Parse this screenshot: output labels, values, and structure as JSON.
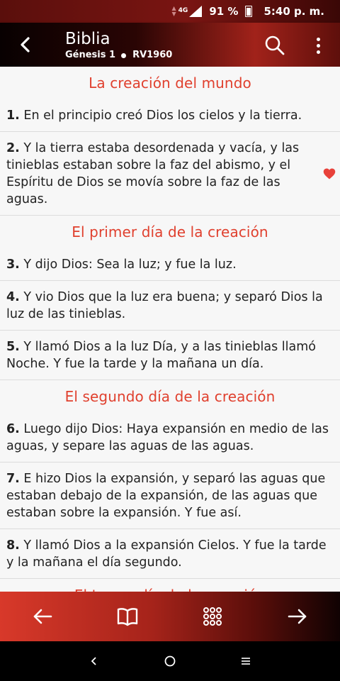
{
  "status_bar": {
    "network": "4G",
    "battery_text": "91 %",
    "battery_level": 0.91,
    "time": "5:40 p. m."
  },
  "app_bar": {
    "title": "Biblia",
    "chapter": "Génesis 1",
    "version": "RV1960"
  },
  "sections": [
    {
      "title": "La creación del mundo",
      "verses": [
        {
          "num": "1.",
          "text": " En el principio creó Dios los cielos y la tierra.",
          "favorite": false
        },
        {
          "num": "2.",
          "text": " Y la tierra estaba desordenada y vacía, y las tinieblas estaban sobre la faz del abismo, y el Espíritu de Dios se movía sobre la faz de las aguas.",
          "favorite": true
        }
      ]
    },
    {
      "title": "El primer día de la creación",
      "verses": [
        {
          "num": "3.",
          "text": " Y dijo Dios: Sea la luz; y fue la luz.",
          "favorite": false
        },
        {
          "num": "4.",
          "text": " Y vio Dios que la luz era buena; y separó Dios la luz de las tinieblas.",
          "favorite": false
        },
        {
          "num": "5.",
          "text": " Y llamó Dios a la luz Día, y a las tinieblas llamó Noche. Y fue la tarde y la mañana un día.",
          "favorite": false
        }
      ]
    },
    {
      "title": "El segundo día de la creación",
      "verses": [
        {
          "num": "6.",
          "text": " Luego dijo Dios: Haya expansión en medio de las aguas, y separe las aguas de las aguas.",
          "favorite": false
        },
        {
          "num": "7.",
          "text": " E hizo Dios la expansión, y separó las aguas que estaban debajo de la expansión, de las aguas que estaban sobre la expansión. Y fue así.",
          "favorite": false
        },
        {
          "num": "8.",
          "text": " Y llamó Dios a la expansión Cielos. Y fue la tarde y la mañana el día segundo.",
          "favorite": false
        }
      ]
    },
    {
      "title": "El tercer día de la creación",
      "verses": []
    }
  ],
  "icons": {
    "back": "arrow-left-icon",
    "search": "search-icon",
    "more": "more-vertical-icon",
    "favorite": "heart-icon",
    "prev": "arrow-left-icon",
    "book": "book-icon",
    "grid": "grid-icon",
    "next": "arrow-right-icon"
  },
  "colors": {
    "accent": "#e0402e",
    "heart": "#e8413a"
  }
}
